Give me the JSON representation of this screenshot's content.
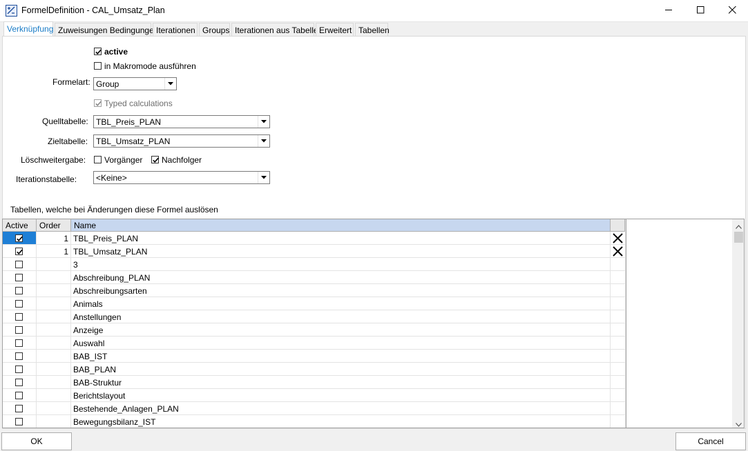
{
  "window": {
    "title": "FormelDefinition - CAL_Umsatz_Plan",
    "minimize_icon": "minimize-icon",
    "maximize_icon": "maximize-icon",
    "close_icon": "close-icon"
  },
  "tabs": [
    {
      "label": "Verknüpfung",
      "active": true
    },
    {
      "label": "Zuweisungen Bedingungen",
      "active": false
    },
    {
      "label": "Iterationen",
      "active": false
    },
    {
      "label": "Groups",
      "active": false
    },
    {
      "label": "Iterationen aus Tabelle",
      "active": false
    },
    {
      "label": "Erweitert",
      "active": false
    },
    {
      "label": "Tabellen",
      "active": false
    }
  ],
  "form": {
    "active_label": "active",
    "active_checked": true,
    "makro_label": "in Makromode ausführen",
    "makro_checked": false,
    "formelart_label": "Formelart:",
    "formelart_value": "Group",
    "typed_label": "Typed calculations",
    "typed_checked": true,
    "quell_label": "Quelltabelle:",
    "quell_value": "TBL_Preis_PLAN",
    "ziel_label": "Zieltabelle:",
    "ziel_value": "TBL_Umsatz_PLAN",
    "loesch_label": "Löschweitergabe:",
    "vorgaenger_label": "Vorgänger",
    "vorgaenger_checked": false,
    "nachfolger_label": "Nachfolger",
    "nachfolger_checked": true,
    "iter_label": "Iterationstabelle:",
    "iter_value": "<Keine>"
  },
  "grid": {
    "caption": "Tabellen, welche bei Änderungen diese Formel auslösen",
    "columns": [
      "Active",
      "Order",
      "Name"
    ],
    "rows": [
      {
        "active": true,
        "order": "1",
        "name": "TBL_Preis_PLAN",
        "delete": true
      },
      {
        "active": true,
        "order": "1",
        "name": "TBL_Umsatz_PLAN",
        "delete": true
      },
      {
        "active": false,
        "order": "",
        "name": "3",
        "delete": false
      },
      {
        "active": false,
        "order": "",
        "name": "Abschreibung_PLAN",
        "delete": false
      },
      {
        "active": false,
        "order": "",
        "name": "Abschreibungsarten",
        "delete": false
      },
      {
        "active": false,
        "order": "",
        "name": "Animals",
        "delete": false
      },
      {
        "active": false,
        "order": "",
        "name": "Anstellungen",
        "delete": false
      },
      {
        "active": false,
        "order": "",
        "name": "Anzeige",
        "delete": false
      },
      {
        "active": false,
        "order": "",
        "name": "Auswahl",
        "delete": false
      },
      {
        "active": false,
        "order": "",
        "name": "BAB_IST",
        "delete": false
      },
      {
        "active": false,
        "order": "",
        "name": "BAB_PLAN",
        "delete": false
      },
      {
        "active": false,
        "order": "",
        "name": "BAB-Struktur",
        "delete": false
      },
      {
        "active": false,
        "order": "",
        "name": "Berichtslayout",
        "delete": false
      },
      {
        "active": false,
        "order": "",
        "name": "Bestehende_Anlagen_PLAN",
        "delete": false
      },
      {
        "active": false,
        "order": "",
        "name": "Bewegungsbilanz_IST",
        "delete": false
      }
    ]
  },
  "buttons": {
    "ok": "OK",
    "cancel": "Cancel"
  }
}
